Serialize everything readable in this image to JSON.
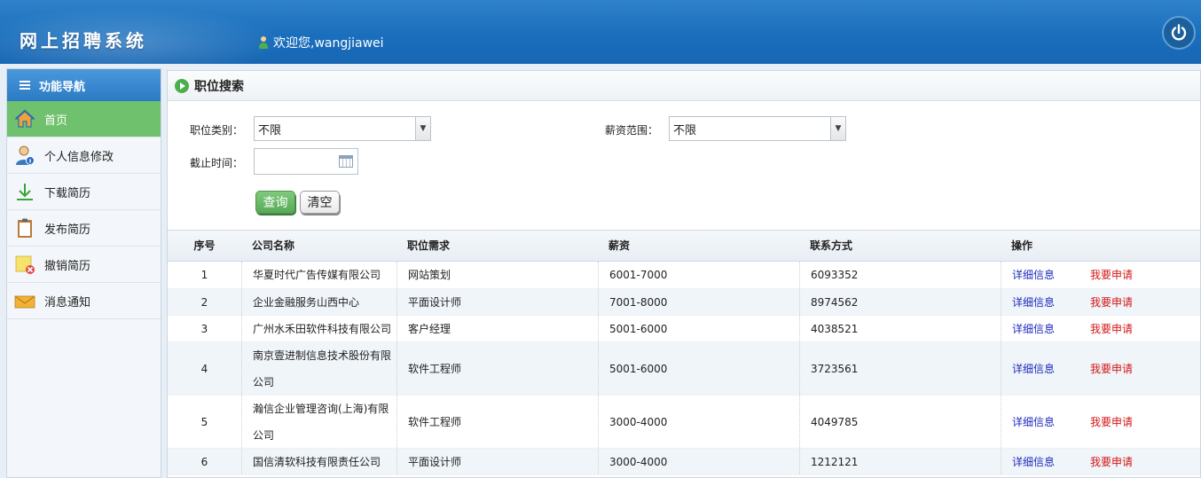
{
  "header": {
    "app_title": "网上招聘系统",
    "welcome_text": "欢迎您,wangjiawei"
  },
  "sidebar": {
    "title": "功能导航",
    "items": [
      {
        "label": "首页",
        "icon": "home-icon",
        "active": true
      },
      {
        "label": "个人信息修改",
        "icon": "user-info-icon",
        "active": false
      },
      {
        "label": "下载简历",
        "icon": "download-icon",
        "active": false
      },
      {
        "label": "发布简历",
        "icon": "clipboard-icon",
        "active": false
      },
      {
        "label": "撤销简历",
        "icon": "note-delete-icon",
        "active": false
      },
      {
        "label": "消息通知",
        "icon": "envelope-icon",
        "active": false
      }
    ]
  },
  "main": {
    "panel_title": "职位搜索",
    "form": {
      "category_label": "职位类别：",
      "category_value": "不限",
      "salary_label": "薪资范围：",
      "salary_value": "不限",
      "deadline_label": "截止时间：",
      "deadline_value": "",
      "query_button": "查询",
      "clear_button": "清空"
    },
    "table": {
      "headers": [
        "序号",
        "公司名称",
        "职位需求",
        "薪资",
        "联系方式",
        "操作"
      ],
      "detail_label": "详细信息",
      "apply_label": "我要申请",
      "rows": [
        {
          "no": "1",
          "company": "华夏时代广告传媒有限公司",
          "position": "网站策划",
          "salary": "6001-7000",
          "contact": "6093352"
        },
        {
          "no": "2",
          "company": "企业金融服务山西中心",
          "position": "平面设计师",
          "salary": "7001-8000",
          "contact": "8974562"
        },
        {
          "no": "3",
          "company": "广州水禾田软件科技有限公司",
          "position": "客户经理",
          "salary": "5001-6000",
          "contact": "4038521"
        },
        {
          "no": "4",
          "company": "南京壹进制信息技术股份有限公司",
          "position": "软件工程师",
          "salary": "5001-6000",
          "contact": "3723561"
        },
        {
          "no": "5",
          "company": "瀚信企业管理咨询(上海)有限公司",
          "position": "软件工程师",
          "salary": "3000-4000",
          "contact": "4049785"
        },
        {
          "no": "6",
          "company": "国信清软科技有限责任公司",
          "position": "平面设计师",
          "salary": "3000-4000",
          "contact": "1212121"
        }
      ]
    }
  },
  "colors": {
    "header_blue": "#1a6fbd",
    "active_green": "#6fc16d",
    "detail_blue": "#1e2bbd",
    "apply_red": "#d41818"
  }
}
